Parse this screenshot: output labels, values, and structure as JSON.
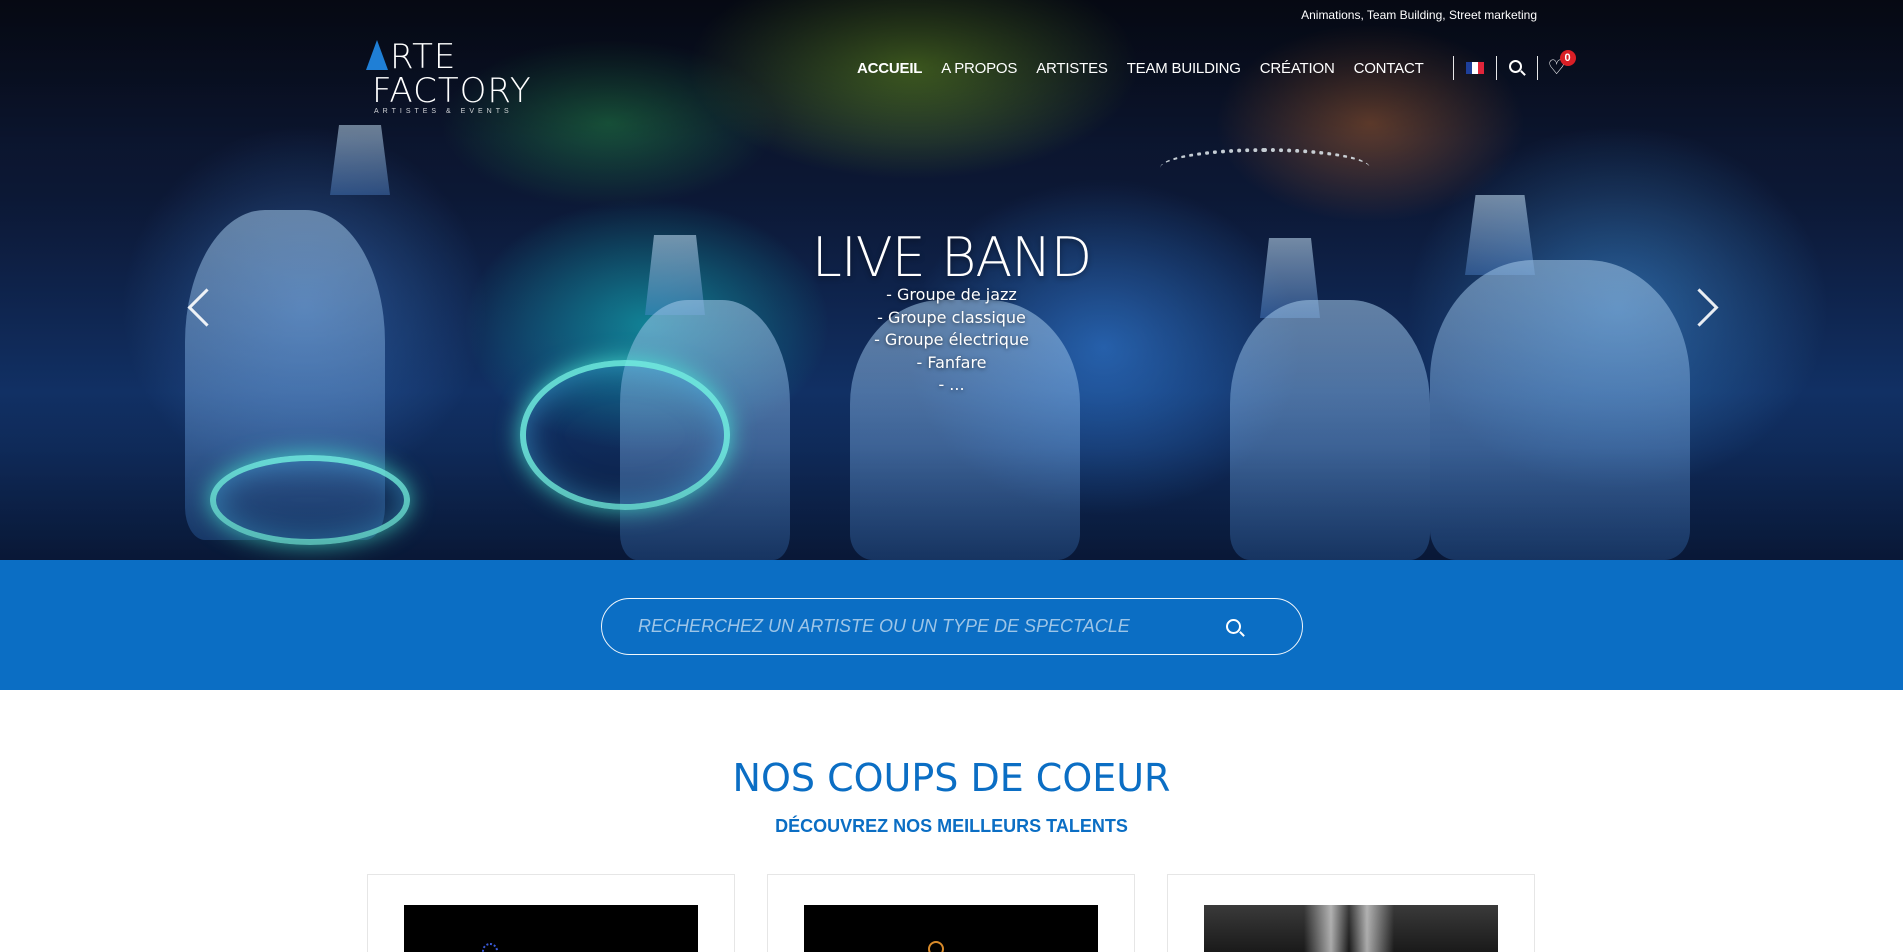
{
  "header": {
    "tagline": "Animations, Team Building, Street marketing",
    "logo": {
      "line1": "RTE",
      "line2": "FACTORY",
      "sub": "ARTISTES & EVENTS"
    },
    "nav": [
      {
        "label": "ACCUEIL",
        "active": true
      },
      {
        "label": "A PROPOS",
        "active": false
      },
      {
        "label": "ARTISTES",
        "active": false
      },
      {
        "label": "TEAM BUILDING",
        "active": false
      },
      {
        "label": "CRÉATION",
        "active": false
      },
      {
        "label": "CONTACT",
        "active": false
      }
    ],
    "language_icon": "french-flag-icon",
    "search_icon": "search-icon",
    "favorites_icon": "heart-icon",
    "favorites_count": "0"
  },
  "slider": {
    "title": "LIVE BAND",
    "lines": [
      "- Groupe de jazz",
      "- Groupe classique",
      "- Groupe électrique",
      "- Fanfare",
      "- ..."
    ],
    "prev_icon": "chevron-left-icon",
    "next_icon": "chevron-right-icon"
  },
  "search": {
    "placeholder": "RECHERCHEZ UN ARTISTE OU UN TYPE DE SPECTACLE",
    "submit_icon": "search-icon"
  },
  "favorites": {
    "title": "NOS COUPS DE COEUR",
    "subtitle": "DÉCOUVREZ NOS MEILLEURS TALENTS",
    "cards": [
      {},
      {},
      {}
    ]
  },
  "colors": {
    "brand_blue": "#0b6ec4",
    "badge_red": "#d91f26",
    "white": "#ffffff"
  }
}
